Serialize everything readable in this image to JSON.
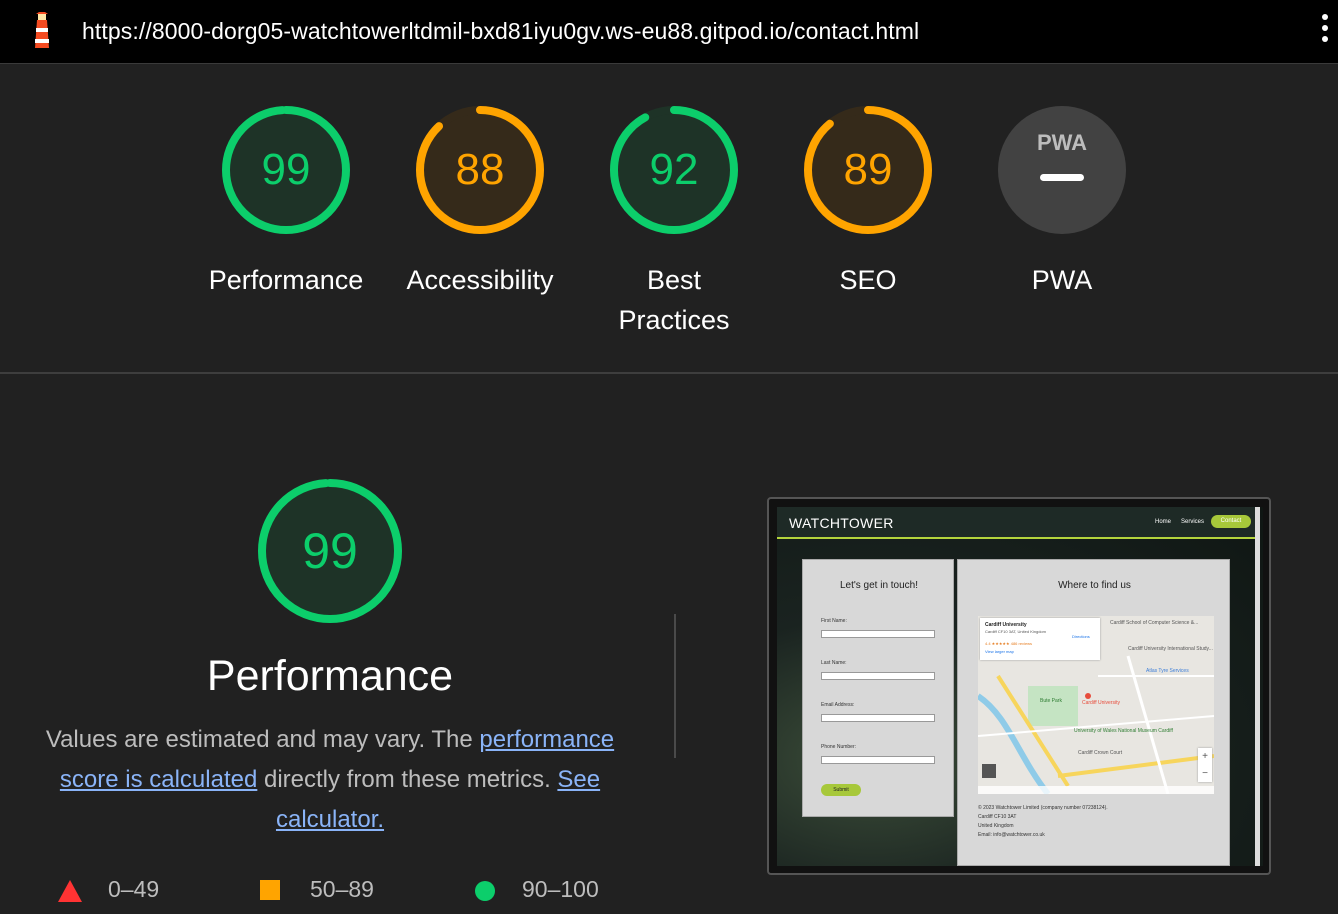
{
  "topbar": {
    "url": "https://8000-dorg05-watchtowerltdmil-bxd81iyu0gv.ws-eu88.gitpod.io/contact.html",
    "icon": "lighthouse-icon",
    "menu_icon": "kebab-menu-icon"
  },
  "gauges": [
    {
      "label": "Performance",
      "score": "99",
      "value": 99,
      "status": "pass",
      "color": "#0cce6b"
    },
    {
      "label": "Accessibility",
      "score": "88",
      "value": 88,
      "status": "average",
      "color": "#ffa400"
    },
    {
      "label": "Best Practices",
      "score": "92",
      "value": 92,
      "status": "pass",
      "color": "#0cce6b"
    },
    {
      "label": "SEO",
      "score": "89",
      "value": 89,
      "status": "average",
      "color": "#ffa400"
    },
    {
      "label": "PWA",
      "score": "",
      "value": null,
      "status": "na",
      "icon": "pwa-icon",
      "badge": "PWA"
    }
  ],
  "performance": {
    "score": "99",
    "value": 99,
    "title": "Performance",
    "desc_prefix": "Values are estimated and may vary. The ",
    "desc_link1": "performance score is calculated",
    "desc_mid": " directly from these metrics. ",
    "desc_link2": "See calculator."
  },
  "legend": [
    {
      "range": "0–49",
      "shape": "triangle",
      "color": "#ff3333"
    },
    {
      "range": "50–89",
      "shape": "square",
      "color": "#ffa400"
    },
    {
      "range": "90–100",
      "shape": "circle",
      "color": "#0cce6b"
    }
  ],
  "thumbnail": {
    "brand": "WATCHTOWER",
    "nav": [
      "Home",
      "Services"
    ],
    "nav_active": "Contact",
    "form_title": "Let's get in touch!",
    "fields": [
      "First Name:",
      "Last Name:",
      "Email Address:",
      "Phone Number:"
    ],
    "submit": "Submit",
    "find_title": "Where to find us",
    "map": {
      "place": "Cardiff University",
      "address": "Cardiff CF10 3AT, United Kingdom",
      "rating": "4.4 ★★★★★  486 reviews",
      "larger_map": "View larger map",
      "directions": "Directions",
      "labels": [
        "Cardiff University",
        "Cardiff School of Computer Science &...",
        "Cardiff University International Study...",
        "Atlas Tyre Services",
        "Bute Park",
        "University of Wales National Museum Cardiff",
        "Cardiff Crown Court"
      ]
    },
    "address_lines": [
      "© 2023 Watchtower Limited (company number 07238124).",
      "Cardiff CF10 3AT",
      "United Kingdom",
      "Email: info@watchtower.co.uk"
    ]
  }
}
